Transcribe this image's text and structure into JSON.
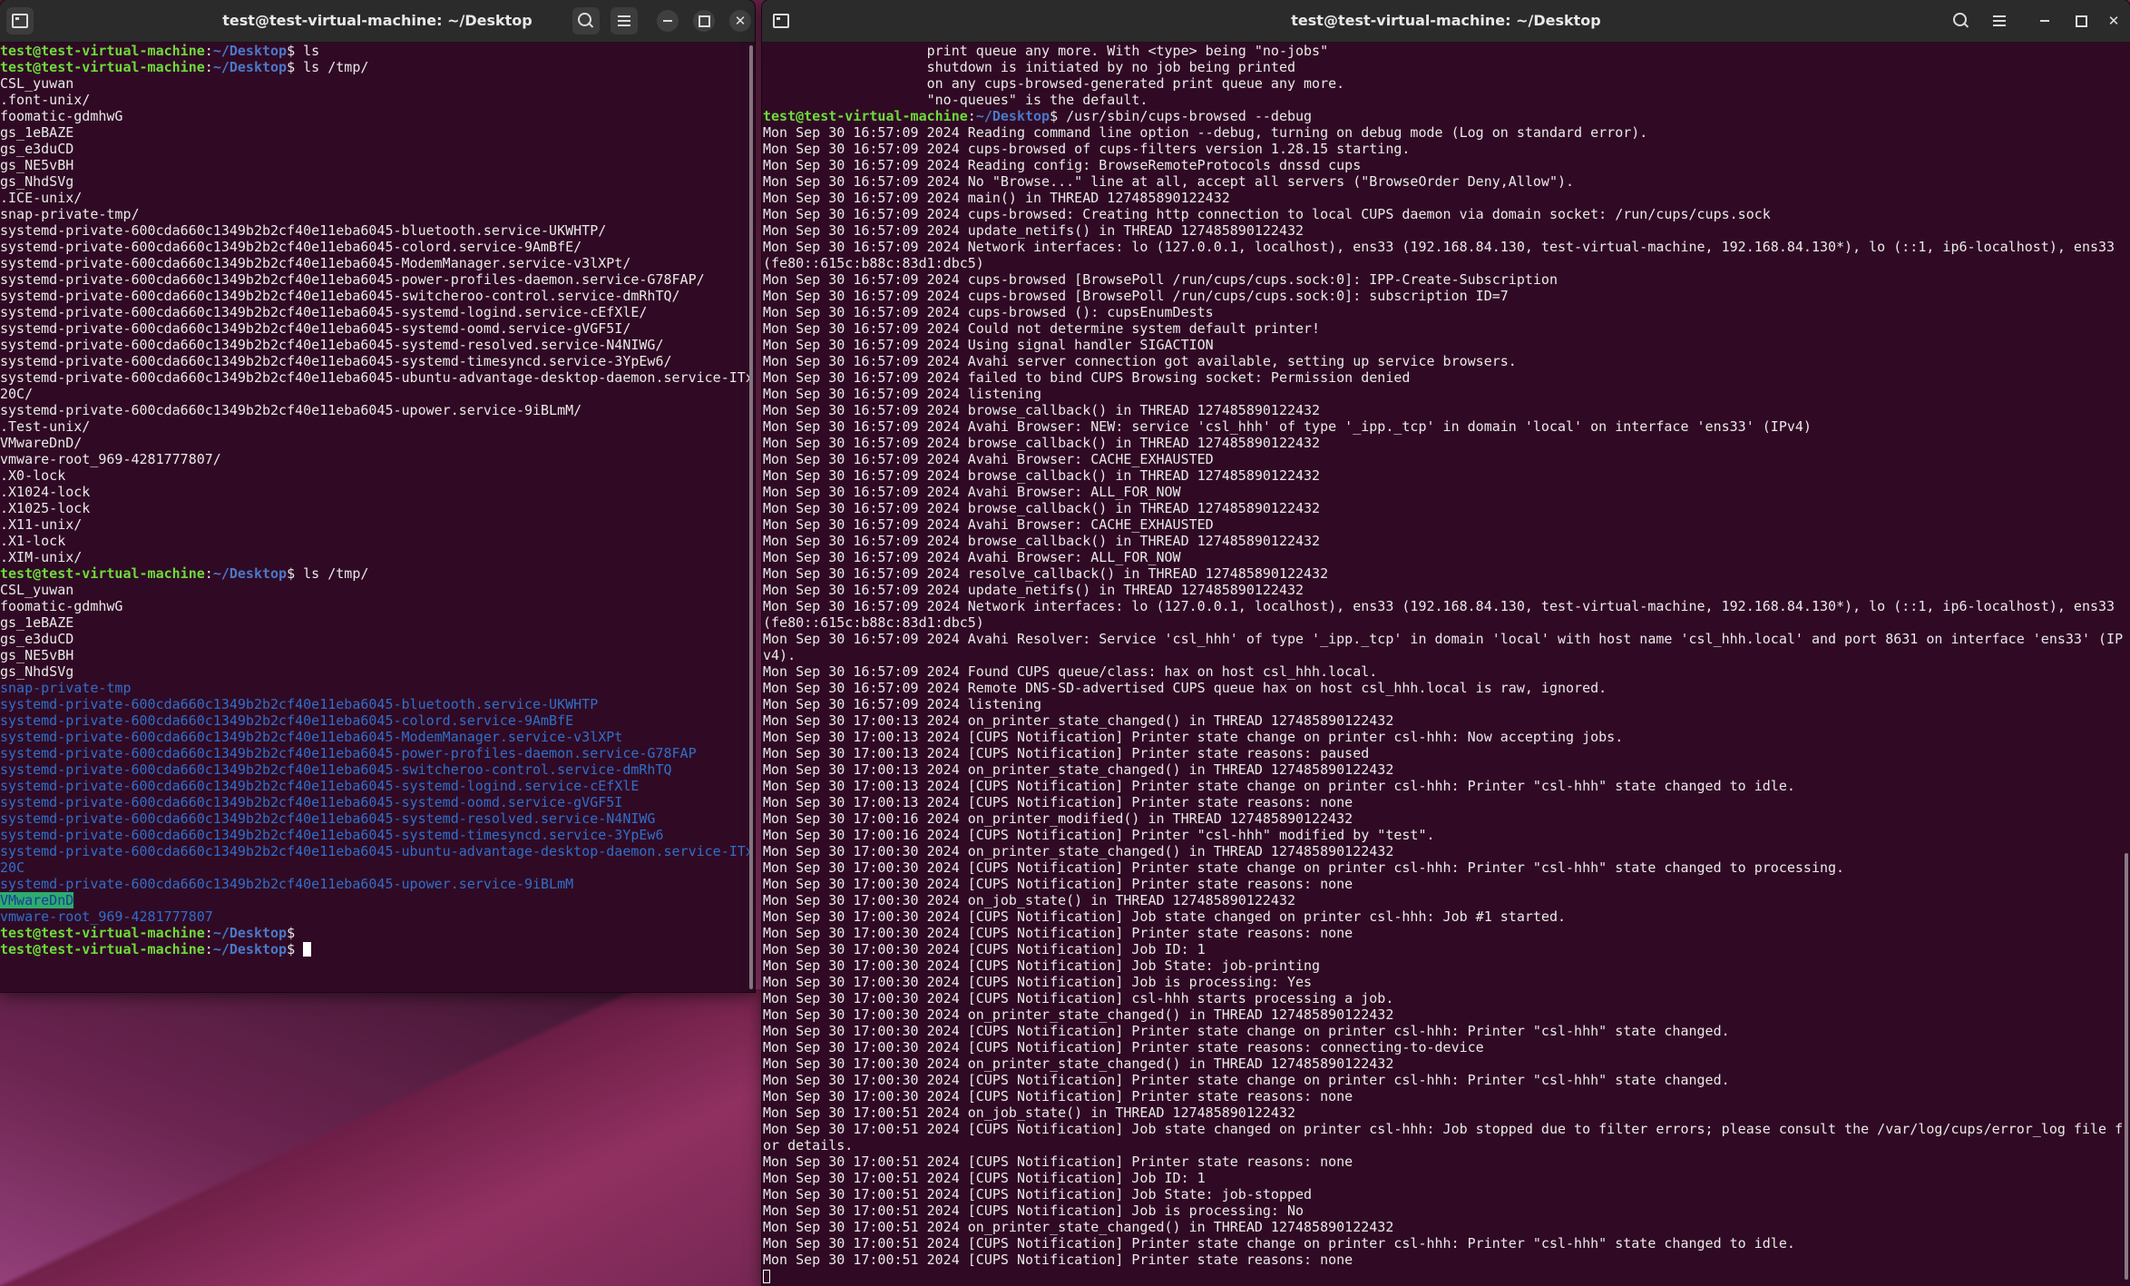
{
  "left_window": {
    "title": "test@test-virtual-machine: ~/Desktop",
    "lines": [
      [
        {
          "t": "test@test-virtual-machine",
          "c": "pu"
        },
        {
          "t": ":",
          "c": "pd"
        },
        {
          "t": "~/Desktop",
          "c": "pp"
        },
        {
          "t": "$ ls",
          "c": "pd"
        }
      ],
      [
        {
          "t": "test@test-virtual-machine",
          "c": "pu"
        },
        {
          "t": ":",
          "c": "pd"
        },
        {
          "t": "~/Desktop",
          "c": "pp"
        },
        {
          "t": "$ ls /tmp/",
          "c": "pd"
        }
      ],
      [
        {
          "t": "CSL_yuwan"
        }
      ],
      [
        {
          "t": ".font-unix/"
        }
      ],
      [
        {
          "t": "foomatic-gdmhwG"
        }
      ],
      [
        {
          "t": "gs_1eBAZE"
        }
      ],
      [
        {
          "t": "gs_e3duCD"
        }
      ],
      [
        {
          "t": "gs_NE5vBH"
        }
      ],
      [
        {
          "t": "gs_NhdSVg"
        }
      ],
      [
        {
          "t": ".ICE-unix/"
        }
      ],
      [
        {
          "t": "snap-private-tmp/"
        }
      ],
      [
        {
          "t": "systemd-private-600cda660c1349b2b2cf40e11eba6045-bluetooth.service-UKWHTP/"
        }
      ],
      [
        {
          "t": "systemd-private-600cda660c1349b2b2cf40e11eba6045-colord.service-9AmBfE/"
        }
      ],
      [
        {
          "t": "systemd-private-600cda660c1349b2b2cf40e11eba6045-ModemManager.service-v3lXPt/"
        }
      ],
      [
        {
          "t": "systemd-private-600cda660c1349b2b2cf40e11eba6045-power-profiles-daemon.service-G78FAP/"
        }
      ],
      [
        {
          "t": "systemd-private-600cda660c1349b2b2cf40e11eba6045-switcheroo-control.service-dmRhTQ/"
        }
      ],
      [
        {
          "t": "systemd-private-600cda660c1349b2b2cf40e11eba6045-systemd-logind.service-cEfXlE/"
        }
      ],
      [
        {
          "t": "systemd-private-600cda660c1349b2b2cf40e11eba6045-systemd-oomd.service-gVGF5I/"
        }
      ],
      [
        {
          "t": "systemd-private-600cda660c1349b2b2cf40e11eba6045-systemd-resolved.service-N4NIWG/"
        }
      ],
      [
        {
          "t": "systemd-private-600cda660c1349b2b2cf40e11eba6045-systemd-timesyncd.service-3YpEw6/"
        }
      ],
      [
        {
          "t": "systemd-private-600cda660c1349b2b2cf40e11eba6045-ubuntu-advantage-desktop-daemon.service-ITx"
        }
      ],
      [
        {
          "t": "20C/"
        }
      ],
      [
        {
          "t": "systemd-private-600cda660c1349b2b2cf40e11eba6045-upower.service-9iBLmM/"
        }
      ],
      [
        {
          "t": ".Test-unix/"
        }
      ],
      [
        {
          "t": "VMwareDnD/"
        }
      ],
      [
        {
          "t": "vmware-root_969-4281777807/"
        }
      ],
      [
        {
          "t": ".X0-lock"
        }
      ],
      [
        {
          "t": ".X1024-lock"
        }
      ],
      [
        {
          "t": ".X1025-lock"
        }
      ],
      [
        {
          "t": ".X11-unix/"
        }
      ],
      [
        {
          "t": ".X1-lock"
        }
      ],
      [
        {
          "t": ".XIM-unix/"
        }
      ],
      [
        {
          "t": "test@test-virtual-machine",
          "c": "pu"
        },
        {
          "t": ":",
          "c": "pd"
        },
        {
          "t": "~/Desktop",
          "c": "pp"
        },
        {
          "t": "$ ls /tmp/",
          "c": "pd"
        }
      ],
      [
        {
          "t": "CSL_yuwan"
        }
      ],
      [
        {
          "t": "foomatic-gdmhwG"
        }
      ],
      [
        {
          "t": "gs_1eBAZE"
        }
      ],
      [
        {
          "t": "gs_e3duCD"
        }
      ],
      [
        {
          "t": "gs_NE5vBH"
        }
      ],
      [
        {
          "t": "gs_NhdSVg"
        }
      ],
      [
        {
          "t": "snap-private-tmp",
          "c": "blue"
        }
      ],
      [
        {
          "t": "systemd-private-600cda660c1349b2b2cf40e11eba6045-bluetooth.service-UKWHTP",
          "c": "blue"
        }
      ],
      [
        {
          "t": "systemd-private-600cda660c1349b2b2cf40e11eba6045-colord.service-9AmBfE",
          "c": "blue"
        }
      ],
      [
        {
          "t": "systemd-private-600cda660c1349b2b2cf40e11eba6045-ModemManager.service-v3lXPt",
          "c": "blue"
        }
      ],
      [
        {
          "t": "systemd-private-600cda660c1349b2b2cf40e11eba6045-power-profiles-daemon.service-G78FAP",
          "c": "blue"
        }
      ],
      [
        {
          "t": "systemd-private-600cda660c1349b2b2cf40e11eba6045-switcheroo-control.service-dmRhTQ",
          "c": "blue"
        }
      ],
      [
        {
          "t": "systemd-private-600cda660c1349b2b2cf40e11eba6045-systemd-logind.service-cEfXlE",
          "c": "blue"
        }
      ],
      [
        {
          "t": "systemd-private-600cda660c1349b2b2cf40e11eba6045-systemd-oomd.service-gVGF5I",
          "c": "blue"
        }
      ],
      [
        {
          "t": "systemd-private-600cda660c1349b2b2cf40e11eba6045-systemd-resolved.service-N4NIWG",
          "c": "blue"
        }
      ],
      [
        {
          "t": "systemd-private-600cda660c1349b2b2cf40e11eba6045-systemd-timesyncd.service-3YpEw6",
          "c": "blue"
        }
      ],
      [
        {
          "t": "systemd-private-600cda660c1349b2b2cf40e11eba6045-ubuntu-advantage-desktop-daemon.service-ITx",
          "c": "blue"
        }
      ],
      [
        {
          "t": "20C",
          "c": "blue"
        }
      ],
      [
        {
          "t": "systemd-private-600cda660c1349b2b2cf40e11eba6045-upower.service-9iBLmM",
          "c": "blue"
        }
      ],
      [
        {
          "t": "VMwareDnD",
          "c": "hl"
        }
      ],
      [
        {
          "t": "vmware-root_969-4281777807",
          "c": "blue"
        }
      ],
      [
        {
          "t": "test@test-virtual-machine",
          "c": "pu"
        },
        {
          "t": ":",
          "c": "pd"
        },
        {
          "t": "~/Desktop",
          "c": "pp"
        },
        {
          "t": "$",
          "c": "pd"
        }
      ],
      [
        {
          "t": "test@test-virtual-machine",
          "c": "pu"
        },
        {
          "t": ":",
          "c": "pd"
        },
        {
          "t": "~/Desktop",
          "c": "pp"
        },
        {
          "t": "$ ",
          "c": "pd"
        },
        {
          "t": "",
          "c": "cursor"
        }
      ]
    ]
  },
  "right_window": {
    "title": "test@test-virtual-machine: ~/Desktop",
    "lines": [
      [
        {
          "t": "                    print queue any more. With <type> being \"no-jobs\""
        }
      ],
      [
        {
          "t": "                    shutdown is initiated by no job being printed"
        }
      ],
      [
        {
          "t": "                    on any cups-browsed-generated print queue any more."
        }
      ],
      [
        {
          "t": "                    \"no-queues\" is the default."
        }
      ],
      [
        {
          "t": "test@test-virtual-machine",
          "c": "pu"
        },
        {
          "t": ":",
          "c": "pd"
        },
        {
          "t": "~/Desktop",
          "c": "pp"
        },
        {
          "t": "$ /usr/sbin/cups-browsed --debug",
          "c": "pd"
        }
      ],
      [
        {
          "t": "Mon Sep 30 16:57:09 2024 Reading command line option --debug, turning on debug mode (Log on standard error)."
        }
      ],
      [
        {
          "t": "Mon Sep 30 16:57:09 2024 cups-browsed of cups-filters version 1.28.15 starting."
        }
      ],
      [
        {
          "t": "Mon Sep 30 16:57:09 2024 Reading config: BrowseRemoteProtocols dnssd cups"
        }
      ],
      [
        {
          "t": "Mon Sep 30 16:57:09 2024 No \"Browse...\" line at all, accept all servers (\"BrowseOrder Deny,Allow\")."
        }
      ],
      [
        {
          "t": "Mon Sep 30 16:57:09 2024 main() in THREAD 127485890122432"
        }
      ],
      [
        {
          "t": "Mon Sep 30 16:57:09 2024 cups-browsed: Creating http connection to local CUPS daemon via domain socket: /run/cups/cups.sock"
        }
      ],
      [
        {
          "t": "Mon Sep 30 16:57:09 2024 update_netifs() in THREAD 127485890122432"
        }
      ],
      [
        {
          "t": "Mon Sep 30 16:57:09 2024 Network interfaces: lo (127.0.0.1, localhost), ens33 (192.168.84.130, test-virtual-machine, 192.168.84.130*), lo (::1, ip6-localhost), ens33"
        }
      ],
      [
        {
          "t": "(fe80::615c:b88c:83d1:dbc5)"
        }
      ],
      [
        {
          "t": "Mon Sep 30 16:57:09 2024 cups-browsed [BrowsePoll /run/cups/cups.sock:0]: IPP-Create-Subscription"
        }
      ],
      [
        {
          "t": "Mon Sep 30 16:57:09 2024 cups-browsed [BrowsePoll /run/cups/cups.sock:0]: subscription ID=7"
        }
      ],
      [
        {
          "t": "Mon Sep 30 16:57:09 2024 cups-browsed (): cupsEnumDests"
        }
      ],
      [
        {
          "t": "Mon Sep 30 16:57:09 2024 Could not determine system default printer!"
        }
      ],
      [
        {
          "t": "Mon Sep 30 16:57:09 2024 Using signal handler SIGACTION"
        }
      ],
      [
        {
          "t": "Mon Sep 30 16:57:09 2024 Avahi server connection got available, setting up service browsers."
        }
      ],
      [
        {
          "t": "Mon Sep 30 16:57:09 2024 failed to bind CUPS Browsing socket: Permission denied"
        }
      ],
      [
        {
          "t": "Mon Sep 30 16:57:09 2024 listening"
        }
      ],
      [
        {
          "t": "Mon Sep 30 16:57:09 2024 browse_callback() in THREAD 127485890122432"
        }
      ],
      [
        {
          "t": "Mon Sep 30 16:57:09 2024 Avahi Browser: NEW: service 'csl_hhh' of type '_ipp._tcp' in domain 'local' on interface 'ens33' (IPv4)"
        }
      ],
      [
        {
          "t": "Mon Sep 30 16:57:09 2024 browse_callback() in THREAD 127485890122432"
        }
      ],
      [
        {
          "t": "Mon Sep 30 16:57:09 2024 Avahi Browser: CACHE_EXHAUSTED"
        }
      ],
      [
        {
          "t": "Mon Sep 30 16:57:09 2024 browse_callback() in THREAD 127485890122432"
        }
      ],
      [
        {
          "t": "Mon Sep 30 16:57:09 2024 Avahi Browser: ALL_FOR_NOW"
        }
      ],
      [
        {
          "t": "Mon Sep 30 16:57:09 2024 browse_callback() in THREAD 127485890122432"
        }
      ],
      [
        {
          "t": "Mon Sep 30 16:57:09 2024 Avahi Browser: CACHE_EXHAUSTED"
        }
      ],
      [
        {
          "t": "Mon Sep 30 16:57:09 2024 browse_callback() in THREAD 127485890122432"
        }
      ],
      [
        {
          "t": "Mon Sep 30 16:57:09 2024 Avahi Browser: ALL_FOR_NOW"
        }
      ],
      [
        {
          "t": "Mon Sep 30 16:57:09 2024 resolve_callback() in THREAD 127485890122432"
        }
      ],
      [
        {
          "t": "Mon Sep 30 16:57:09 2024 update_netifs() in THREAD 127485890122432"
        }
      ],
      [
        {
          "t": "Mon Sep 30 16:57:09 2024 Network interfaces: lo (127.0.0.1, localhost), ens33 (192.168.84.130, test-virtual-machine, 192.168.84.130*), lo (::1, ip6-localhost), ens33"
        }
      ],
      [
        {
          "t": "(fe80::615c:b88c:83d1:dbc5)"
        }
      ],
      [
        {
          "t": "Mon Sep 30 16:57:09 2024 Avahi Resolver: Service 'csl_hhh' of type '_ipp._tcp' in domain 'local' with host name 'csl_hhh.local' and port 8631 on interface 'ens33' (IP"
        }
      ],
      [
        {
          "t": "v4)."
        }
      ],
      [
        {
          "t": "Mon Sep 30 16:57:09 2024 Found CUPS queue/class: hax on host csl_hhh.local."
        }
      ],
      [
        {
          "t": "Mon Sep 30 16:57:09 2024 Remote DNS-SD-advertised CUPS queue hax on host csl_hhh.local is raw, ignored."
        }
      ],
      [
        {
          "t": "Mon Sep 30 16:57:09 2024 listening"
        }
      ],
      [
        {
          "t": "Mon Sep 30 17:00:13 2024 on_printer_state_changed() in THREAD 127485890122432"
        }
      ],
      [
        {
          "t": "Mon Sep 30 17:00:13 2024 [CUPS Notification] Printer state change on printer csl-hhh: Now accepting jobs."
        }
      ],
      [
        {
          "t": "Mon Sep 30 17:00:13 2024 [CUPS Notification] Printer state reasons: paused"
        }
      ],
      [
        {
          "t": "Mon Sep 30 17:00:13 2024 on_printer_state_changed() in THREAD 127485890122432"
        }
      ],
      [
        {
          "t": "Mon Sep 30 17:00:13 2024 [CUPS Notification] Printer state change on printer csl-hhh: Printer \"csl-hhh\" state changed to idle."
        }
      ],
      [
        {
          "t": "Mon Sep 30 17:00:13 2024 [CUPS Notification] Printer state reasons: none"
        }
      ],
      [
        {
          "t": "Mon Sep 30 17:00:16 2024 on_printer_modified() in THREAD 127485890122432"
        }
      ],
      [
        {
          "t": "Mon Sep 30 17:00:16 2024 [CUPS Notification] Printer \"csl-hhh\" modified by \"test\"."
        }
      ],
      [
        {
          "t": "Mon Sep 30 17:00:30 2024 on_printer_state_changed() in THREAD 127485890122432"
        }
      ],
      [
        {
          "t": "Mon Sep 30 17:00:30 2024 [CUPS Notification] Printer state change on printer csl-hhh: Printer \"csl-hhh\" state changed to processing."
        }
      ],
      [
        {
          "t": "Mon Sep 30 17:00:30 2024 [CUPS Notification] Printer state reasons: none"
        }
      ],
      [
        {
          "t": "Mon Sep 30 17:00:30 2024 on_job_state() in THREAD 127485890122432"
        }
      ],
      [
        {
          "t": "Mon Sep 30 17:00:30 2024 [CUPS Notification] Job state changed on printer csl-hhh: Job #1 started."
        }
      ],
      [
        {
          "t": "Mon Sep 30 17:00:30 2024 [CUPS Notification] Printer state reasons: none"
        }
      ],
      [
        {
          "t": "Mon Sep 30 17:00:30 2024 [CUPS Notification] Job ID: 1"
        }
      ],
      [
        {
          "t": "Mon Sep 30 17:00:30 2024 [CUPS Notification] Job State: job-printing"
        }
      ],
      [
        {
          "t": "Mon Sep 30 17:00:30 2024 [CUPS Notification] Job is processing: Yes"
        }
      ],
      [
        {
          "t": "Mon Sep 30 17:00:30 2024 [CUPS Notification] csl-hhh starts processing a job."
        }
      ],
      [
        {
          "t": "Mon Sep 30 17:00:30 2024 on_printer_state_changed() in THREAD 127485890122432"
        }
      ],
      [
        {
          "t": "Mon Sep 30 17:00:30 2024 [CUPS Notification] Printer state change on printer csl-hhh: Printer \"csl-hhh\" state changed."
        }
      ],
      [
        {
          "t": "Mon Sep 30 17:00:30 2024 [CUPS Notification] Printer state reasons: connecting-to-device"
        }
      ],
      [
        {
          "t": "Mon Sep 30 17:00:30 2024 on_printer_state_changed() in THREAD 127485890122432"
        }
      ],
      [
        {
          "t": "Mon Sep 30 17:00:30 2024 [CUPS Notification] Printer state change on printer csl-hhh: Printer \"csl-hhh\" state changed."
        }
      ],
      [
        {
          "t": "Mon Sep 30 17:00:30 2024 [CUPS Notification] Printer state reasons: none"
        }
      ],
      [
        {
          "t": "Mon Sep 30 17:00:51 2024 on_job_state() in THREAD 127485890122432"
        }
      ],
      [
        {
          "t": "Mon Sep 30 17:00:51 2024 [CUPS Notification] Job state changed on printer csl-hhh: Job stopped due to filter errors; please consult the /var/log/cups/error_log file f"
        }
      ],
      [
        {
          "t": "or details."
        }
      ],
      [
        {
          "t": "Mon Sep 30 17:00:51 2024 [CUPS Notification] Printer state reasons: none"
        }
      ],
      [
        {
          "t": "Mon Sep 30 17:00:51 2024 [CUPS Notification] Job ID: 1"
        }
      ],
      [
        {
          "t": "Mon Sep 30 17:00:51 2024 [CUPS Notification] Job State: job-stopped"
        }
      ],
      [
        {
          "t": "Mon Sep 30 17:00:51 2024 [CUPS Notification] Job is processing: No"
        }
      ],
      [
        {
          "t": "Mon Sep 30 17:00:51 2024 on_printer_state_changed() in THREAD 127485890122432"
        }
      ],
      [
        {
          "t": "Mon Sep 30 17:00:51 2024 [CUPS Notification] Printer state change on printer csl-hhh: Printer \"csl-hhh\" state changed to idle."
        }
      ],
      [
        {
          "t": "Mon Sep 30 17:00:51 2024 [CUPS Notification] Printer state reasons: none"
        }
      ],
      [
        {
          "t": "",
          "c": "cursor-o"
        }
      ]
    ]
  }
}
